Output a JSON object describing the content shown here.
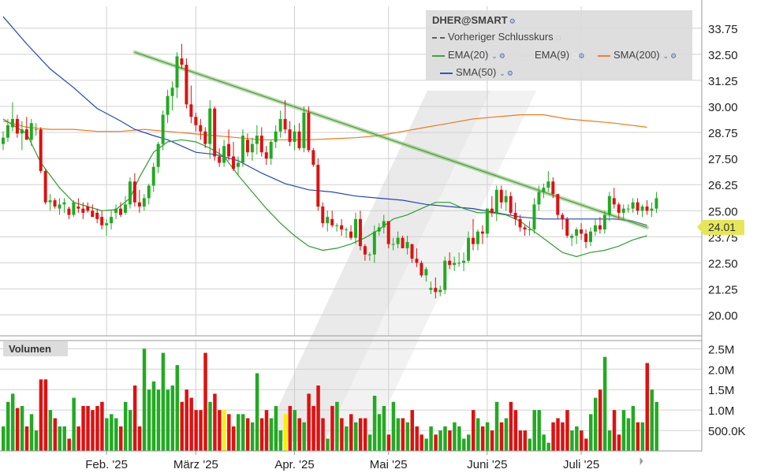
{
  "legend": {
    "title": "DHER@SMART",
    "prev_close_label": "Vorheriger Schlusskurs",
    "ema20_label": "EMA(20)",
    "ema9_label": "EMA(9)",
    "sma200_label": "SMA(200)",
    "sma50_label": "SMA(50)"
  },
  "volume_label": "Volumen",
  "last_price_label": "24.01",
  "colors": {
    "up": "#22aa22",
    "down": "#dd1111",
    "highlight": "#ffee00",
    "ema20": "#2ca02c",
    "sma200": "#f07a1a",
    "sma50": "#2346b8",
    "trendline": "#7fc36a",
    "grid": "#d0d0d0",
    "last_price": "#e6e65a"
  },
  "chart_data": {
    "type": "candlestick",
    "price_ylim": [
      19.0,
      34.8
    ],
    "volume_ylim": [
      0,
      2700000
    ],
    "price_ticks": [
      20.0,
      21.25,
      22.5,
      23.75,
      25.0,
      26.25,
      27.5,
      28.75,
      30.0,
      31.25,
      32.5,
      33.75
    ],
    "price_tick_labels": [
      "20.00",
      "21.25",
      "22.50",
      "23.75",
      "25.00",
      "26.25",
      "27.50",
      "28.75",
      "30.00",
      "31.25",
      "32.50",
      "33.75"
    ],
    "volume_ticks": [
      500000,
      1000000,
      1500000,
      2000000,
      2500000
    ],
    "volume_tick_labels": [
      "500.0K",
      "1.0M",
      "1.5M",
      "2.0M",
      "2.5M"
    ],
    "x_month_labels": [
      {
        "label": "Feb. '25",
        "day": 22
      },
      {
        "label": "März '25",
        "day": 41
      },
      {
        "label": "Apr. '25",
        "day": 62
      },
      {
        "label": "Mai '25",
        "day": 82
      },
      {
        "label": "Juni '25",
        "day": 103
      },
      {
        "label": "Juli '25",
        "day": 123
      }
    ],
    "x_gridlines_day": [
      22,
      41,
      62,
      82,
      103,
      123
    ],
    "last_price": 24.01,
    "trendline": {
      "start": {
        "day": 28,
        "price": 32.6
      },
      "end": {
        "day": 137,
        "price": 24.2
      }
    },
    "ema20": [
      [
        0,
        29.4
      ],
      [
        5,
        28.7
      ],
      [
        8,
        27.3
      ],
      [
        12,
        26.1
      ],
      [
        15,
        25.4
      ],
      [
        18,
        25.2
      ],
      [
        21,
        25.0
      ],
      [
        24,
        25.05
      ],
      [
        27,
        25.6
      ],
      [
        29,
        26.6
      ],
      [
        32,
        27.8
      ],
      [
        35,
        28.3
      ],
      [
        38,
        28.4
      ],
      [
        41,
        28.3
      ],
      [
        44,
        28.0
      ],
      [
        47,
        27.6
      ],
      [
        50,
        26.7
      ],
      [
        53,
        25.9
      ],
      [
        56,
        25.1
      ],
      [
        59,
        24.4
      ],
      [
        62,
        23.8
      ],
      [
        65,
        23.3
      ],
      [
        68,
        23.1
      ],
      [
        71,
        23.2
      ],
      [
        74,
        23.4
      ],
      [
        77,
        23.7
      ],
      [
        80,
        24.1
      ],
      [
        83,
        24.6
      ],
      [
        86,
        24.8
      ],
      [
        89,
        25.1
      ],
      [
        92,
        25.4
      ],
      [
        95,
        25.4
      ],
      [
        98,
        25.1
      ],
      [
        101,
        24.9
      ],
      [
        104,
        24.9
      ],
      [
        107,
        24.8
      ],
      [
        110,
        24.5
      ],
      [
        113,
        24.0
      ],
      [
        116,
        23.5
      ],
      [
        119,
        23.0
      ],
      [
        122,
        22.8
      ],
      [
        125,
        23.0
      ],
      [
        128,
        23.1
      ],
      [
        131,
        23.3
      ],
      [
        134,
        23.6
      ],
      [
        137,
        23.8
      ]
    ],
    "sma50": [
      [
        0,
        34.3
      ],
      [
        5,
        33.0
      ],
      [
        10,
        31.8
      ],
      [
        15,
        30.9
      ],
      [
        20,
        29.9
      ],
      [
        25,
        29.3
      ],
      [
        28,
        28.9
      ],
      [
        32,
        28.6
      ],
      [
        35,
        28.4
      ],
      [
        38,
        28.1
      ],
      [
        41,
        27.8
      ],
      [
        45,
        27.7
      ],
      [
        50,
        27.4
      ],
      [
        55,
        26.8
      ],
      [
        60,
        26.3
      ],
      [
        65,
        26.0
      ],
      [
        70,
        25.9
      ],
      [
        75,
        25.7
      ],
      [
        80,
        25.6
      ],
      [
        85,
        25.5
      ],
      [
        90,
        25.3
      ],
      [
        95,
        25.2
      ],
      [
        100,
        25.1
      ],
      [
        105,
        24.9
      ],
      [
        110,
        24.7
      ],
      [
        115,
        24.6
      ],
      [
        120,
        24.6
      ],
      [
        125,
        24.6
      ],
      [
        130,
        24.6
      ],
      [
        134,
        24.5
      ],
      [
        137,
        24.3
      ]
    ],
    "sma200": [
      [
        0,
        29.3
      ],
      [
        5,
        29.0
      ],
      [
        10,
        28.9
      ],
      [
        15,
        28.9
      ],
      [
        20,
        28.8
      ],
      [
        25,
        28.8
      ],
      [
        30,
        28.9
      ],
      [
        35,
        28.8
      ],
      [
        40,
        28.7
      ],
      [
        45,
        28.6
      ],
      [
        50,
        28.5
      ],
      [
        55,
        28.4
      ],
      [
        60,
        28.4
      ],
      [
        65,
        28.4
      ],
      [
        70,
        28.45
      ],
      [
        75,
        28.5
      ],
      [
        80,
        28.6
      ],
      [
        85,
        28.8
      ],
      [
        90,
        29.0
      ],
      [
        95,
        29.2
      ],
      [
        100,
        29.4
      ],
      [
        105,
        29.5
      ],
      [
        110,
        29.6
      ],
      [
        115,
        29.6
      ],
      [
        120,
        29.4
      ],
      [
        125,
        29.3
      ],
      [
        130,
        29.2
      ],
      [
        137,
        29.0
      ]
    ],
    "candles": [
      [
        28.2,
        28.8,
        27.9,
        28.5,
        0.6
      ],
      [
        28.5,
        29.4,
        28.3,
        29.1,
        1.2
      ],
      [
        29.0,
        30.2,
        28.8,
        29.4,
        1.4
      ],
      [
        29.4,
        29.6,
        28.5,
        28.7,
        1.05
      ],
      [
        28.7,
        29.3,
        27.9,
        28.9,
        1.1
      ],
      [
        28.9,
        29.5,
        28.4,
        28.4,
        0.6
      ],
      [
        28.4,
        29.4,
        28.1,
        29.2,
        0.9
      ],
      [
        28.9,
        29.2,
        28.6,
        28.9,
        0.5
      ],
      [
        28.9,
        29.0,
        26.8,
        26.9,
        1.75
      ],
      [
        26.9,
        27.0,
        25.3,
        25.4,
        1.75
      ],
      [
        25.4,
        25.8,
        25.0,
        25.5,
        1.0
      ],
      [
        25.5,
        25.6,
        25.1,
        25.2,
        0.8
      ],
      [
        25.1,
        25.6,
        24.8,
        25.3,
        0.6
      ],
      [
        25.3,
        25.6,
        24.9,
        25.4,
        0.6
      ],
      [
        25.1,
        25.2,
        24.6,
        24.8,
        0.3
      ],
      [
        24.8,
        25.5,
        24.7,
        25.4,
        1.3
      ],
      [
        25.2,
        25.6,
        24.9,
        25.1,
        0.6
      ],
      [
        25.1,
        25.4,
        24.6,
        24.9,
        1.1
      ],
      [
        25.2,
        25.4,
        24.9,
        25.0,
        1.1
      ],
      [
        25.0,
        25.3,
        24.7,
        24.7,
        1.0
      ],
      [
        24.9,
        25.1,
        24.4,
        24.6,
        1.1
      ],
      [
        24.7,
        25.0,
        24.1,
        24.3,
        1.2
      ],
      [
        24.3,
        24.6,
        23.8,
        24.4,
        0.8
      ],
      [
        24.4,
        25.0,
        24.1,
        24.7,
        0.9
      ],
      [
        24.9,
        25.3,
        24.6,
        25.1,
        0.8
      ],
      [
        25.1,
        25.4,
        24.7,
        24.8,
        0.6
      ],
      [
        24.9,
        25.7,
        24.8,
        25.3,
        1.2
      ],
      [
        25.3,
        26.6,
        25.1,
        26.4,
        1.0
      ],
      [
        26.4,
        26.8,
        25.2,
        25.4,
        1.6
      ],
      [
        25.4,
        26.0,
        24.9,
        25.2,
        0.6
      ],
      [
        25.2,
        25.8,
        25.0,
        25.6,
        2.5
      ],
      [
        25.6,
        26.3,
        25.3,
        26.2,
        1.5
      ],
      [
        26.2,
        27.3,
        25.9,
        27.1,
        1.7
      ],
      [
        27.1,
        28.3,
        26.8,
        28.2,
        1.5
      ],
      [
        28.2,
        29.8,
        27.9,
        29.6,
        2.4
      ],
      [
        29.6,
        30.8,
        29.2,
        30.5,
        1.5
      ],
      [
        30.5,
        31.2,
        29.8,
        30.9,
        1.6
      ],
      [
        30.9,
        32.6,
        30.4,
        32.4,
        2.1
      ],
      [
        32.3,
        33.0,
        31.8,
        32.0,
        1.2
      ],
      [
        32.0,
        32.3,
        29.9,
        30.1,
        1.5
      ],
      [
        30.1,
        31.0,
        29.2,
        29.5,
        1.3
      ],
      [
        29.5,
        29.7,
        28.8,
        29.1,
        1.0
      ],
      [
        29.1,
        29.4,
        28.4,
        28.8,
        1.0
      ],
      [
        28.8,
        29.0,
        28.0,
        28.2,
        2.4
      ],
      [
        28.2,
        30.3,
        27.5,
        29.9,
        1.2
      ],
      [
        29.9,
        30.0,
        27.4,
        27.6,
        1.4
      ],
      [
        27.6,
        28.0,
        27.1,
        27.3,
        1.0
      ],
      [
        27.3,
        28.4,
        27.1,
        28.1,
        1.0
      ],
      [
        28.2,
        28.9,
        27.4,
        27.6,
        0.9
      ],
      [
        27.6,
        28.3,
        26.9,
        27.0,
        0.6
      ],
      [
        27.1,
        27.6,
        26.7,
        27.3,
        0.9
      ],
      [
        27.3,
        28.9,
        27.1,
        28.6,
        0.9
      ],
      [
        28.4,
        28.7,
        27.6,
        27.8,
        0.8
      ],
      [
        27.8,
        28.5,
        27.4,
        28.2,
        0.7
      ],
      [
        28.2,
        29.1,
        27.7,
        28.6,
        1.9
      ],
      [
        28.6,
        29.0,
        27.6,
        27.8,
        0.8
      ],
      [
        27.8,
        28.1,
        27.2,
        27.5,
        1.0
      ],
      [
        27.5,
        28.4,
        27.2,
        28.3,
        0.8
      ],
      [
        28.3,
        29.1,
        28.0,
        28.8,
        1.1
      ],
      [
        28.8,
        29.8,
        28.5,
        29.4,
        0.5
      ],
      [
        29.4,
        30.3,
        28.7,
        28.9,
        0.9
      ],
      [
        28.9,
        29.3,
        28.1,
        28.3,
        1.1
      ],
      [
        28.3,
        29.1,
        27.9,
        28.8,
        1.0
      ],
      [
        28.8,
        29.2,
        27.9,
        28.0,
        0.8
      ],
      [
        28.0,
        30.0,
        27.8,
        29.7,
        0.7
      ],
      [
        29.7,
        30.0,
        27.8,
        27.9,
        1.4
      ],
      [
        27.9,
        28.0,
        27.1,
        27.2,
        1.1
      ],
      [
        27.2,
        27.5,
        25.0,
        25.2,
        1.6
      ],
      [
        25.2,
        25.4,
        24.2,
        24.4,
        0.8
      ],
      [
        24.4,
        25.0,
        24.0,
        24.7,
        0.3
      ],
      [
        24.6,
        25.0,
        24.2,
        24.3,
        1.1
      ],
      [
        24.3,
        24.4,
        24.0,
        24.3,
        1.2
      ],
      [
        24.3,
        24.6,
        23.8,
        24.1,
        0.8
      ],
      [
        24.1,
        24.2,
        23.7,
        24.1,
        0.6
      ],
      [
        24.0,
        24.3,
        23.6,
        23.7,
        0.9
      ],
      [
        23.7,
        24.9,
        23.4,
        24.6,
        0.7
      ],
      [
        24.6,
        25.0,
        23.1,
        23.3,
        0.8
      ],
      [
        23.3,
        23.4,
        22.6,
        22.9,
        0.8
      ],
      [
        22.9,
        23.0,
        22.6,
        22.9,
        0.4
      ],
      [
        22.9,
        24.3,
        22.5,
        24.0,
        1.35
      ],
      [
        24.0,
        24.4,
        23.8,
        24.2,
        0.9
      ],
      [
        24.2,
        24.8,
        23.9,
        24.5,
        1.1
      ],
      [
        24.5,
        24.5,
        23.2,
        23.4,
        0.4
      ],
      [
        23.4,
        23.7,
        23.1,
        23.4,
        1.2
      ],
      [
        23.4,
        24.0,
        23.2,
        23.7,
        0.8
      ],
      [
        23.7,
        23.8,
        23.2,
        23.2,
        0.8
      ],
      [
        23.2,
        23.8,
        22.9,
        23.5,
        0.7
      ],
      [
        23.4,
        23.4,
        22.5,
        22.7,
        1.0
      ],
      [
        22.7,
        23.2,
        22.3,
        22.5,
        0.6
      ],
      [
        22.5,
        22.6,
        21.8,
        21.9,
        0.4
      ],
      [
        21.9,
        22.3,
        21.6,
        22.2,
        0.3
      ],
      [
        21.2,
        21.6,
        21.0,
        21.3,
        0.6
      ],
      [
        21.3,
        21.8,
        20.8,
        21.1,
        0.4
      ],
      [
        21.1,
        21.4,
        20.9,
        21.2,
        0.5
      ],
      [
        21.2,
        22.8,
        21.0,
        22.6,
        0.6
      ],
      [
        22.6,
        23.0,
        22.2,
        22.4,
        0.5
      ],
      [
        22.4,
        22.8,
        22.1,
        22.5,
        0.7
      ],
      [
        22.5,
        23.0,
        22.3,
        22.5,
        0.6
      ],
      [
        22.5,
        23.0,
        22.1,
        22.6,
        0.3
      ],
      [
        22.6,
        24.0,
        22.5,
        23.7,
        0.4
      ],
      [
        23.7,
        24.6,
        23.1,
        23.4,
        1.0
      ],
      [
        23.4,
        24.1,
        23.1,
        24.0,
        0.8
      ],
      [
        24.0,
        24.3,
        23.4,
        23.9,
        0.6
      ],
      [
        23.9,
        25.1,
        23.7,
        25.1,
        0.7
      ],
      [
        25.1,
        25.7,
        24.7,
        24.9,
        0.5
      ],
      [
        24.9,
        26.2,
        24.5,
        26.0,
        1.2
      ],
      [
        26.0,
        26.2,
        25.1,
        25.4,
        0.7
      ],
      [
        25.4,
        26.0,
        25.0,
        25.7,
        0.8
      ],
      [
        25.7,
        25.9,
        24.8,
        24.9,
        1.2
      ],
      [
        24.9,
        25.4,
        24.3,
        24.6,
        1.0
      ],
      [
        24.6,
        24.8,
        24.0,
        24.2,
        0.5
      ],
      [
        24.2,
        24.3,
        23.8,
        24.1,
        0.5
      ],
      [
        24.1,
        24.5,
        23.8,
        24.1,
        0.3
      ],
      [
        24.1,
        25.6,
        23.9,
        25.3,
        1.0
      ],
      [
        25.3,
        26.2,
        25.0,
        25.9,
        1.0
      ],
      [
        25.9,
        26.3,
        25.6,
        26.1,
        0.4
      ],
      [
        26.1,
        26.9,
        25.9,
        26.4,
        0.2
      ],
      [
        26.4,
        26.6,
        25.6,
        25.8,
        0.7
      ],
      [
        25.8,
        25.8,
        24.6,
        24.8,
        0.8
      ],
      [
        24.8,
        24.9,
        24.1,
        24.6,
        0.7
      ],
      [
        24.6,
        24.7,
        23.7,
        23.8,
        1.0
      ],
      [
        23.7,
        23.9,
        23.3,
        23.8,
        0.5
      ],
      [
        23.8,
        24.2,
        23.4,
        24.1,
        0.6
      ],
      [
        24.1,
        24.4,
        23.6,
        23.9,
        0.5
      ],
      [
        23.9,
        24.1,
        23.2,
        23.5,
        0.3
      ],
      [
        23.5,
        24.2,
        23.3,
        24.0,
        0.9
      ],
      [
        24.0,
        24.6,
        23.8,
        24.3,
        1.3
      ],
      [
        24.3,
        24.7,
        23.9,
        24.1,
        1.5
      ],
      [
        24.1,
        25.0,
        23.9,
        24.8,
        2.3
      ],
      [
        24.8,
        25.9,
        24.5,
        25.7,
        0.5
      ],
      [
        25.6,
        26.1,
        25.1,
        25.3,
        1.0
      ],
      [
        25.3,
        25.4,
        24.6,
        24.9,
        0.4
      ],
      [
        24.9,
        25.3,
        24.6,
        25.1,
        1.0
      ],
      [
        25.1,
        25.3,
        24.9,
        25.1,
        0.8
      ],
      [
        25.1,
        25.6,
        24.9,
        25.4,
        1.1
      ],
      [
        25.4,
        25.6,
        24.8,
        25.0,
        0.7
      ],
      [
        25.0,
        25.3,
        24.7,
        25.2,
        0.7
      ],
      [
        25.2,
        25.5,
        24.8,
        25.0,
        2.15
      ],
      [
        25.0,
        25.4,
        24.7,
        25.1,
        1.5
      ],
      [
        25.1,
        25.9,
        24.9,
        25.6,
        1.2
      ]
    ]
  }
}
